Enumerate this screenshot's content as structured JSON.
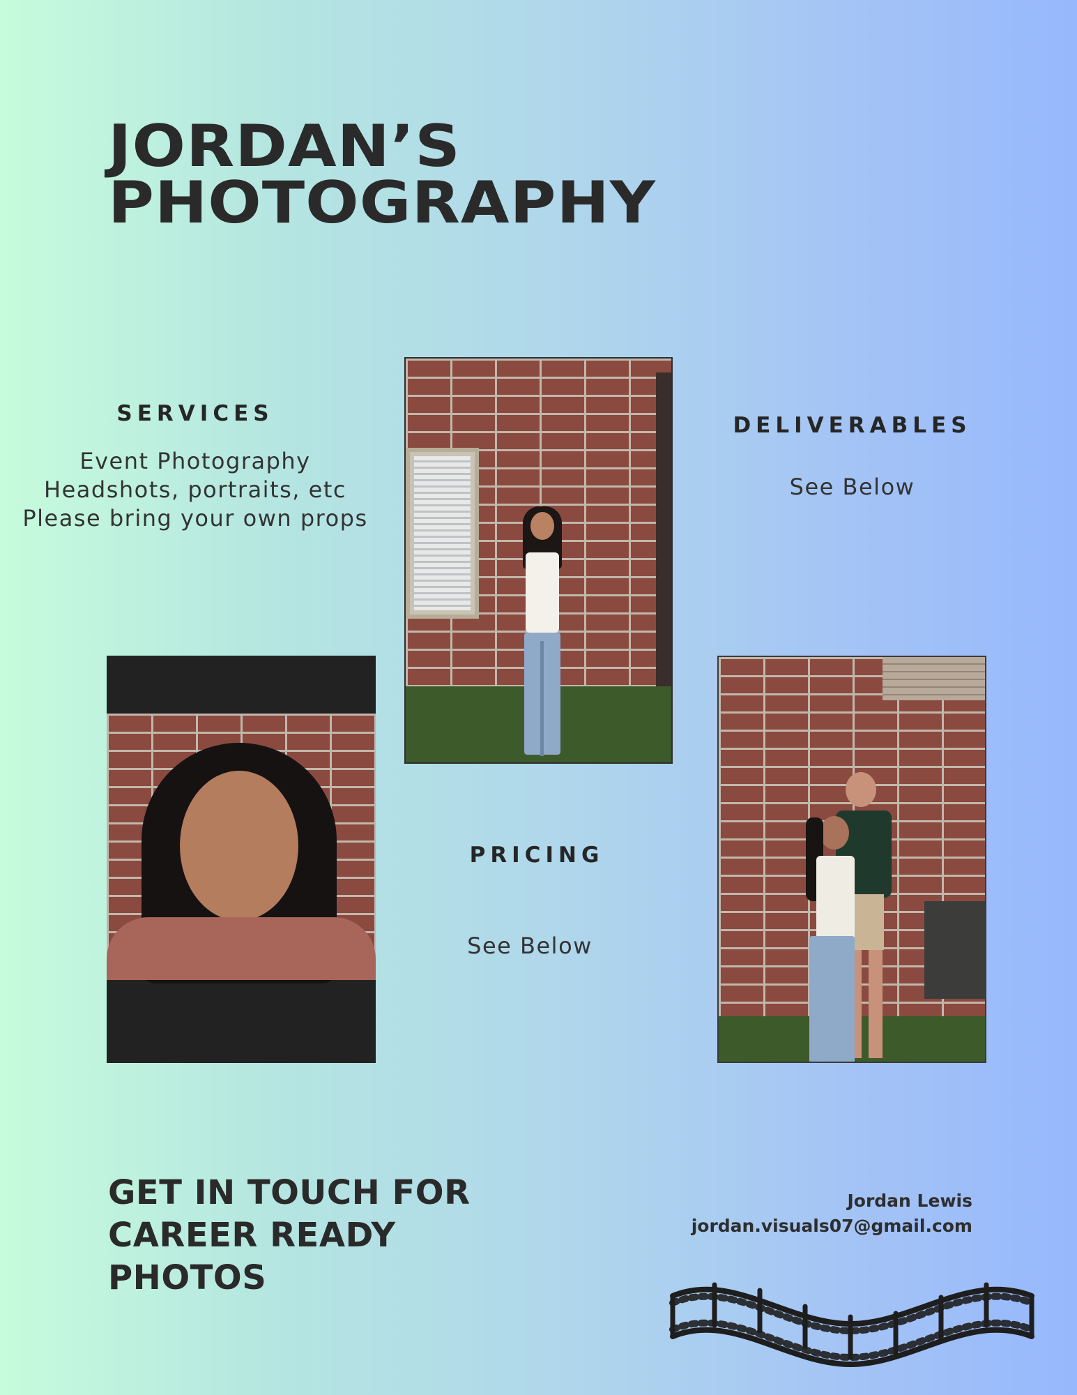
{
  "title": {
    "line1": "JORDAN’S",
    "line2": "PHOTOGRAPHY"
  },
  "services": {
    "heading": "SERVICES",
    "lines": [
      "Event Photography",
      "Headshots, portraits, etc",
      "Please bring your own props"
    ]
  },
  "deliverables": {
    "heading": "DELIVERABLES",
    "text": "See Below"
  },
  "pricing": {
    "heading": "PRICING",
    "text": "See Below"
  },
  "cta": {
    "line1": "GET IN TOUCH FOR",
    "line2": "CAREER READY",
    "line3": "PHOTOS"
  },
  "contact": {
    "name": "Jordan Lewis",
    "email": "jordan.visuals07@gmail.com"
  },
  "colors": {
    "gradient_start": "#c6fcdc",
    "gradient_end": "#97b8fc",
    "text": "#2a2a2a"
  }
}
